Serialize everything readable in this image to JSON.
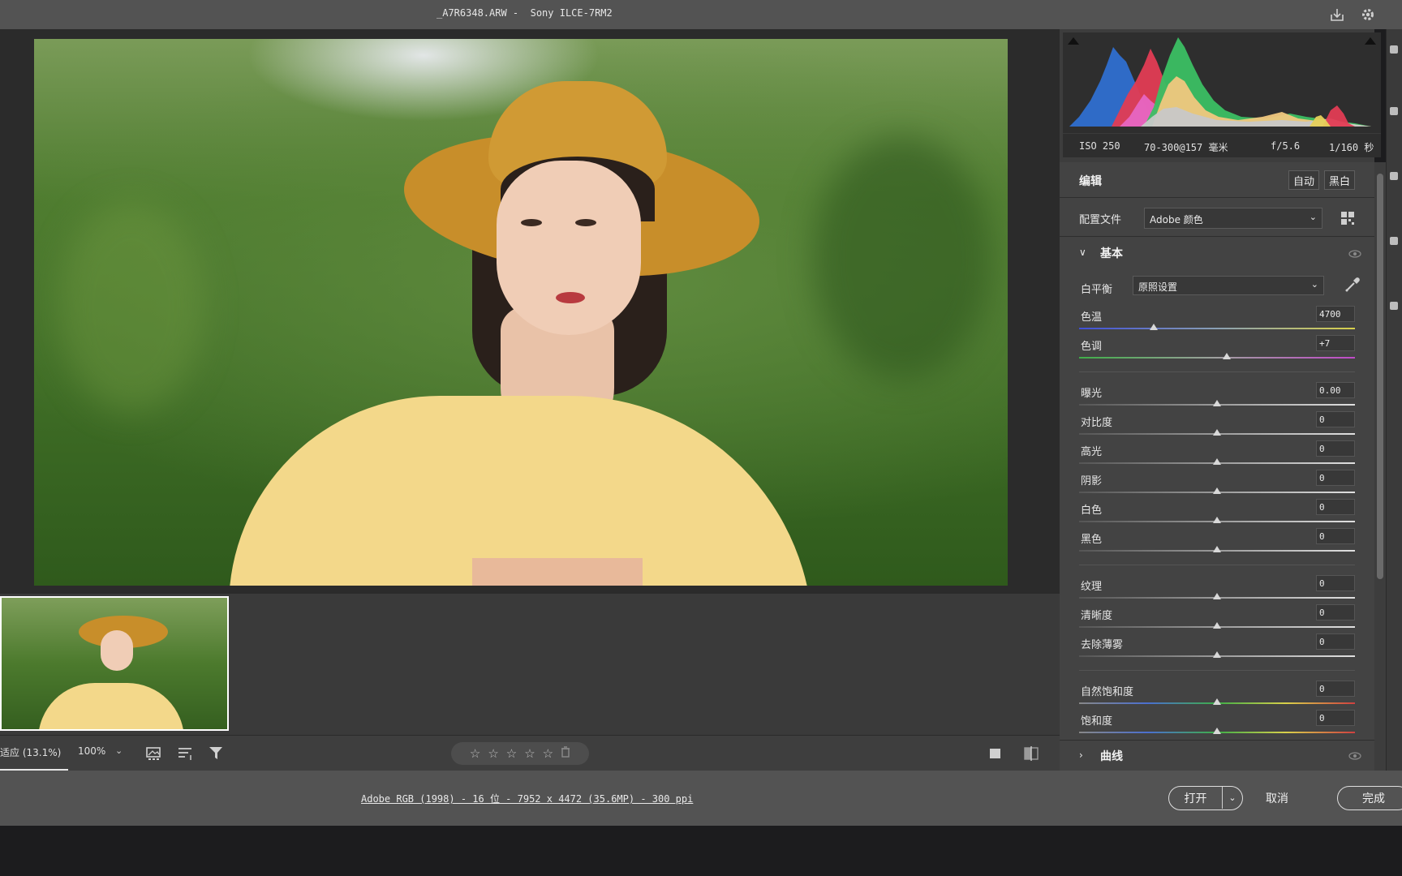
{
  "window": {
    "title": "_A7R6348.ARW -  Sony ILCE-7RM2"
  },
  "exif": {
    "iso": "ISO 250",
    "lens": "70-300@157 毫米",
    "aperture": "f/5.6",
    "shutter": "1/160 秒"
  },
  "edit": {
    "title": "编辑",
    "auto_label": "自动",
    "bw_label": "黑白",
    "profile_label": "配置文件",
    "profile_value": "Adobe 颜色"
  },
  "basic": {
    "title": "基本",
    "wb_label": "白平衡",
    "wb_value": "原照设置",
    "sliders": [
      {
        "label": "色温",
        "value": "4700",
        "level": 0.27
      },
      {
        "label": "色调",
        "value": "+7",
        "level": 0.535
      },
      {
        "label": "曝光",
        "value": "0.00",
        "level": 0.5
      },
      {
        "label": "对比度",
        "value": "0",
        "level": 0.5
      },
      {
        "label": "高光",
        "value": "0",
        "level": 0.5
      },
      {
        "label": "阴影",
        "value": "0",
        "level": 0.5
      },
      {
        "label": "白色",
        "value": "0",
        "level": 0.5
      },
      {
        "label": "黑色",
        "value": "0",
        "level": 0.5
      },
      {
        "label": "纹理",
        "value": "0",
        "level": 0.5
      },
      {
        "label": "清晰度",
        "value": "0",
        "level": 0.5
      },
      {
        "label": "去除薄雾",
        "value": "0",
        "level": 0.5
      },
      {
        "label": "自然饱和度",
        "value": "0",
        "level": 0.5
      },
      {
        "label": "饱和度",
        "value": "0",
        "level": 0.5
      }
    ]
  },
  "curve": {
    "title": "曲线"
  },
  "toolbar": {
    "zoom_fit": "适应 (13.1%)",
    "zoom_value": "100%",
    "rating_stars": [
      "☆",
      "☆",
      "☆",
      "☆",
      "☆"
    ]
  },
  "footer": {
    "workflow": "Adobe RGB (1998) - 16 位 - 7952 x 4472 (35.6MP) - 300 ppi",
    "open_label": "打开",
    "cancel_label": "取消",
    "done_label": "完成"
  },
  "icons": {
    "export": "export-icon",
    "settings": "gear-icon",
    "eyedropper": "eyedropper-icon",
    "eye": "eye-icon",
    "profile_browser": "grid-icon",
    "trash": "trash-icon",
    "filmstrip": "filmstrip-icon",
    "sort": "sort-icon",
    "filter": "filter-icon",
    "single_view": "single-view-icon",
    "before_after": "before-after-icon"
  },
  "colors": {
    "panel": "#434343",
    "topbar": "#535353",
    "accent_text": "#f2f2f2"
  }
}
